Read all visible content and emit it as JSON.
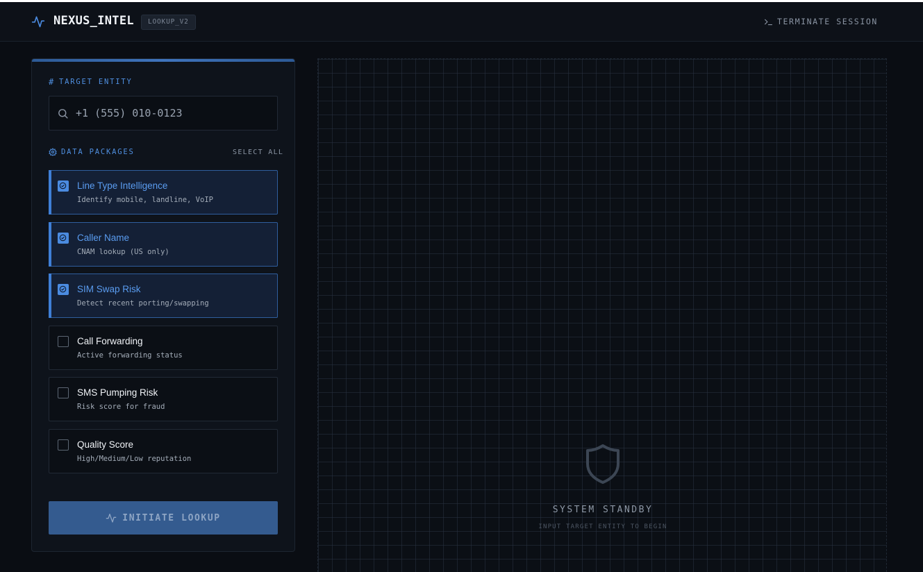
{
  "header": {
    "brand": "NEXUS_INTEL",
    "version_badge": "LOOKUP_V2",
    "terminate_label": "TERMINATE SESSION"
  },
  "target": {
    "label": "TARGET ENTITY",
    "placeholder": "+1 (555) 010-0123"
  },
  "packages": {
    "label": "DATA PACKAGES",
    "select_all": "SELECT ALL",
    "items": [
      {
        "title": "Line Type Intelligence",
        "desc": "Identify mobile, landline, VoIP",
        "selected": true
      },
      {
        "title": "Caller Name",
        "desc": "CNAM lookup (US only)",
        "selected": true
      },
      {
        "title": "SIM Swap Risk",
        "desc": "Detect recent porting/swapping",
        "selected": true
      },
      {
        "title": "Call Forwarding",
        "desc": "Active forwarding status",
        "selected": false
      },
      {
        "title": "SMS Pumping Risk",
        "desc": "Risk score for fraud",
        "selected": false
      },
      {
        "title": "Quality Score",
        "desc": "High/Medium/Low reputation",
        "selected": false
      }
    ]
  },
  "action": {
    "initiate_label": "INITIATE LOOKUP"
  },
  "standby": {
    "title": "SYSTEM STANDBY",
    "subtitle": "INPUT TARGET ENTITY TO BEGIN"
  },
  "colors": {
    "accent": "#4b8be0",
    "background": "#0a0d13",
    "panel": "#0e131b",
    "selected_bg": "#142036"
  }
}
